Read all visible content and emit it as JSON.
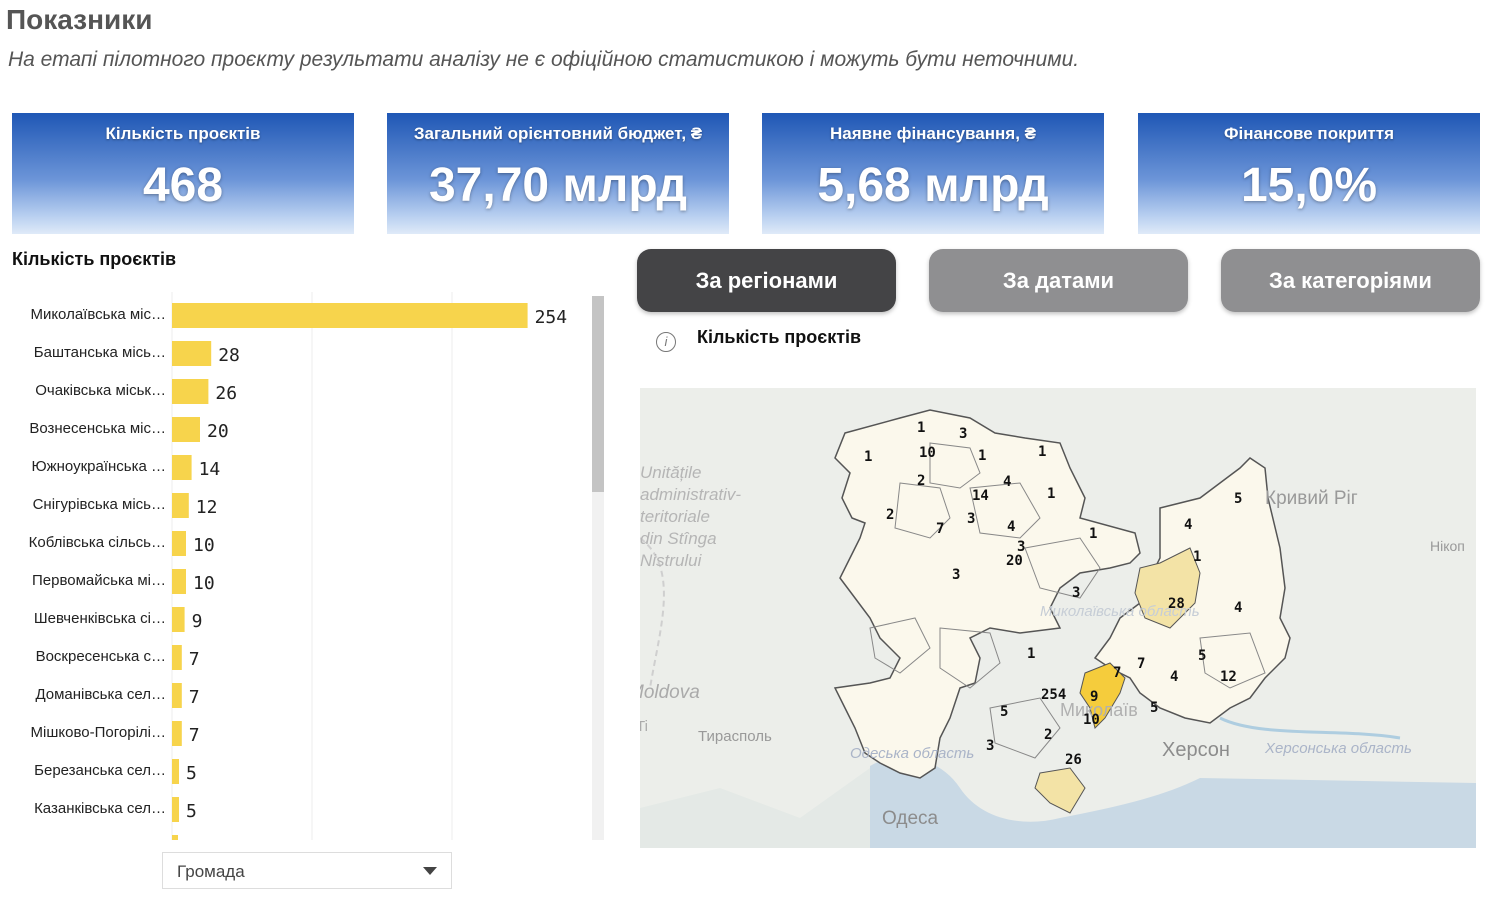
{
  "header": {
    "title": "Показники",
    "subtitle": "На етапі пілотного проєкту результати аналізу не є офіційною статистикою і можуть бути неточними."
  },
  "kpis": [
    {
      "label": "Кількість проєктів",
      "value": "468"
    },
    {
      "label": "Загальний орієнтовний бюджет, ₴",
      "value": "37,70 млрд"
    },
    {
      "label": "Наявне фінансування, ₴",
      "value": "5,68 млрд"
    },
    {
      "label": "Фінансове покриття",
      "value": "15,0%"
    }
  ],
  "bar_section": {
    "title": "Кількість проєктів"
  },
  "chart_data": {
    "type": "bar",
    "orientation": "horizontal",
    "categories": [
      "Миколаївська міс…",
      "Баштанська місь…",
      "Очаківська міськ…",
      "Вознесенська міс…",
      "Южноукраїнська …",
      "Снігурівська місь…",
      "Коблівська сільсь…",
      "Первомайська мі…",
      "Шевченківська сі…",
      "Воскресенська с…",
      "Доманівська сел…",
      "Мішково-Погорілі…",
      "Березанська сел…",
      "Казанківська сел…"
    ],
    "values": [
      254,
      28,
      26,
      20,
      14,
      12,
      10,
      10,
      9,
      7,
      7,
      7,
      5,
      5
    ],
    "bar_color": "#f7d44c",
    "grid": true
  },
  "dropdown": {
    "label": "Громада"
  },
  "tabs": [
    {
      "label": "За регіонами",
      "active": true
    },
    {
      "label": "За датами",
      "active": false
    },
    {
      "label": "За категоріями",
      "active": false
    }
  ],
  "map_section": {
    "title": "Кількість проєктів"
  },
  "map": {
    "region_labels": [
      "1",
      "3",
      "10",
      "1",
      "1",
      "1",
      "2",
      "4",
      "1",
      "14",
      "2",
      "7",
      "3",
      "4",
      "3",
      "20",
      "1",
      "3",
      "5",
      "4",
      "1",
      "28",
      "4",
      "3",
      "1",
      "7",
      "7",
      "12",
      "5",
      "4",
      "254",
      "9",
      "5",
      "5",
      "10",
      "3",
      "2",
      "26"
    ],
    "place_labels": {
      "kryvyi_rih": "Кривий Ріг",
      "nikopol": "Нікоп",
      "tiraspol": "Тирасполь",
      "kherson": "Херсон",
      "odesa": "Одеса",
      "odeska_oblast": "Одеська область",
      "khersonska_oblast": "Херсонська область",
      "mykolaivska_oblast": "Миколаївська область",
      "mykolaiv": "Миколаїв",
      "ro_lines": [
        "Unitățile",
        "administrativ-",
        "teritoriale",
        "din Stînga",
        "Nistrului"
      ],
      "moldova": "Moldova",
      "ti": "Ti"
    },
    "highlight_colors": {
      "max": "#f5cc3c",
      "mid": "#f3e3a6",
      "low": "#fbf8e9"
    }
  }
}
